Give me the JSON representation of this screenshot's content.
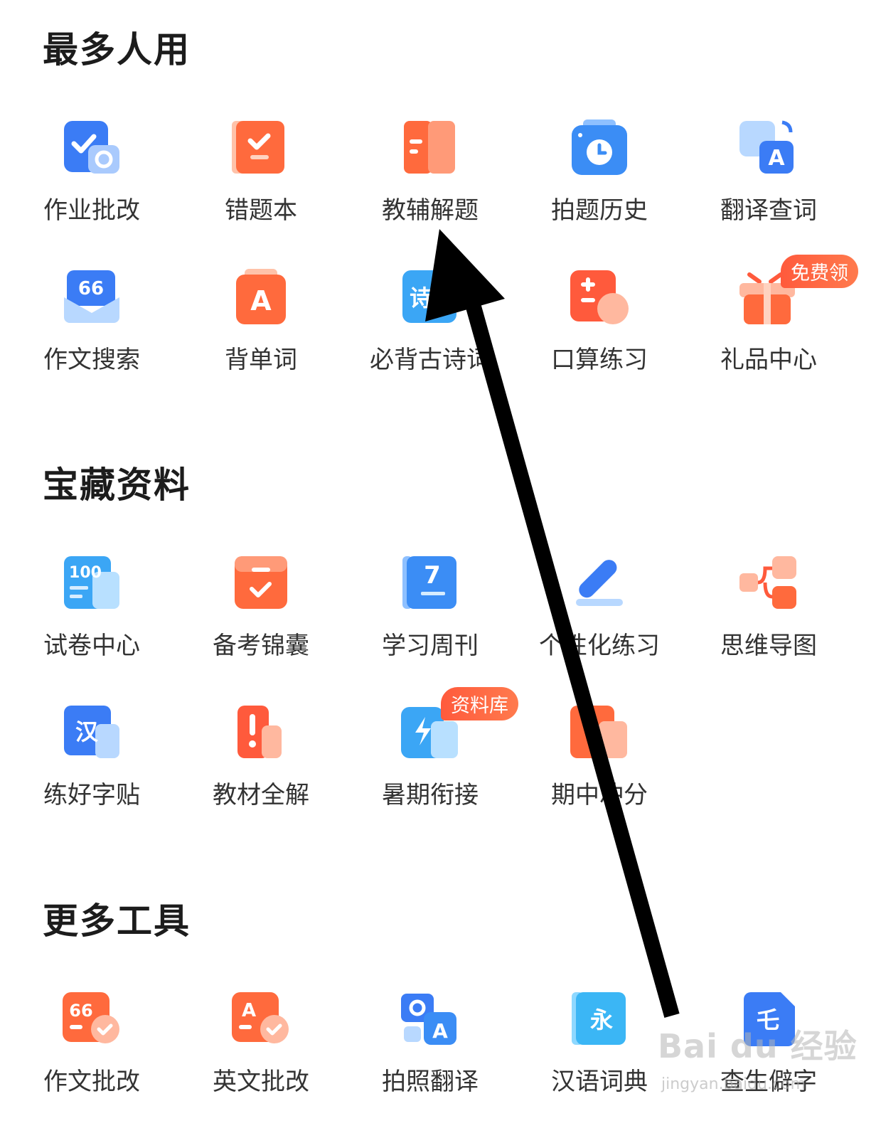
{
  "sections": [
    {
      "title": "最多人用",
      "items": [
        {
          "label": "作业批改",
          "icon": "homework-check-icon"
        },
        {
          "label": "错题本",
          "icon": "mistake-book-icon"
        },
        {
          "label": "教辅解题",
          "icon": "tutorial-book-icon"
        },
        {
          "label": "拍题历史",
          "icon": "photo-history-icon"
        },
        {
          "label": "翻译查词",
          "icon": "translate-icon"
        },
        {
          "label": "作文搜索",
          "icon": "essay-search-icon"
        },
        {
          "label": "背单词",
          "icon": "vocab-icon"
        },
        {
          "label": "必背古诗词",
          "icon": "poetry-icon"
        },
        {
          "label": "口算练习",
          "icon": "mental-math-icon"
        },
        {
          "label": "礼品中心",
          "icon": "gift-icon",
          "badge": "免费领"
        }
      ]
    },
    {
      "title": "宝藏资料",
      "items": [
        {
          "label": "试卷中心",
          "icon": "exam-paper-icon"
        },
        {
          "label": "备考锦囊",
          "icon": "exam-kit-icon"
        },
        {
          "label": "学习周刊",
          "icon": "weekly-icon"
        },
        {
          "label": "个性化练习",
          "icon": "personal-practice-icon"
        },
        {
          "label": "思维导图",
          "icon": "mind-map-icon"
        },
        {
          "label": "练好字贴",
          "icon": "calligraphy-icon"
        },
        {
          "label": "教材全解",
          "icon": "textbook-icon"
        },
        {
          "label": "暑期衔接",
          "icon": "summer-bridge-icon",
          "badge": "资料库"
        },
        {
          "label": "期中冲分",
          "icon": "midterm-icon"
        }
      ]
    },
    {
      "title": "更多工具",
      "items": [
        {
          "label": "作文批改",
          "icon": "essay-correct-icon"
        },
        {
          "label": "英文批改",
          "icon": "english-correct-icon"
        },
        {
          "label": "拍照翻译",
          "icon": "photo-translate-icon"
        },
        {
          "label": "汉语词典",
          "icon": "dictionary-icon"
        },
        {
          "label": "查生僻字",
          "icon": "rare-char-icon"
        }
      ]
    }
  ],
  "watermark": {
    "text": "Bai du 经验",
    "sub": "jingyan.baidu.com"
  },
  "colors": {
    "blue": "#3b7cf5",
    "orange": "#ff6a3d",
    "red_badge": "#ff5a3c",
    "text": "#333333"
  }
}
